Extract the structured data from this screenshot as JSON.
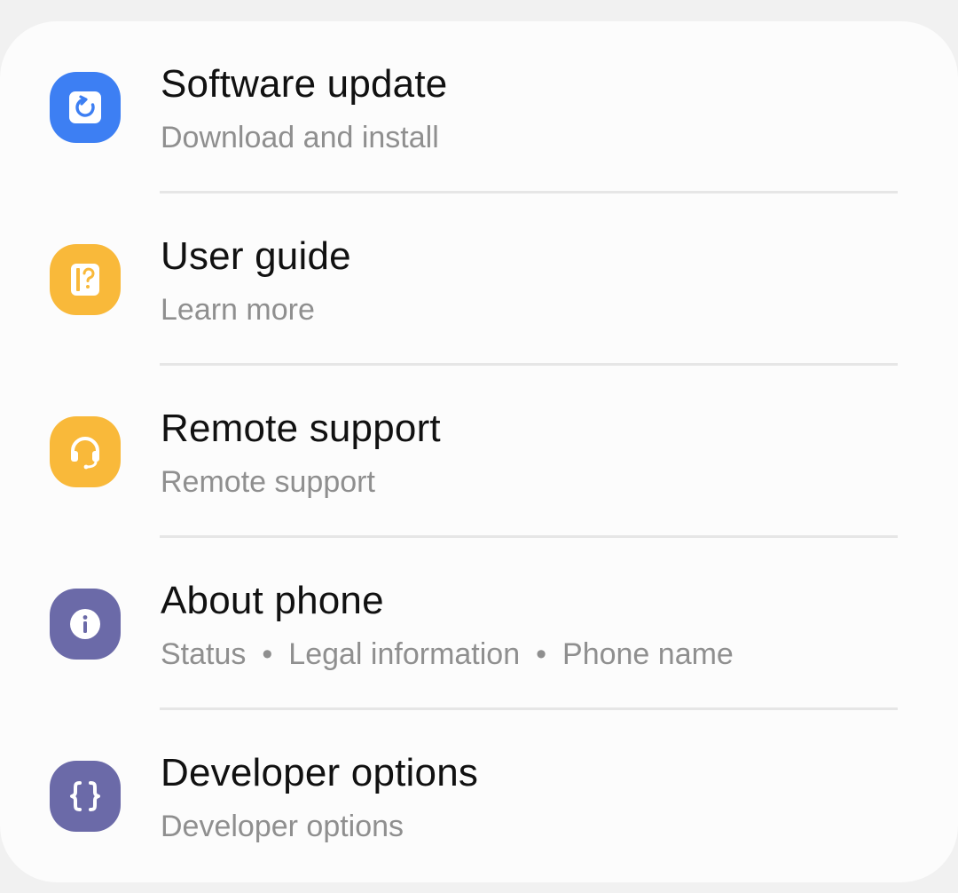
{
  "colors": {
    "software_update": "#3d7ff3",
    "user_guide": "#f9b93a",
    "remote_support": "#f9b93a",
    "about_phone": "#6b6aa8",
    "developer_options": "#6b6aa8"
  },
  "items": [
    {
      "icon": "refresh-icon",
      "title": "Software update",
      "subtitle": "Download and install"
    },
    {
      "icon": "book-help-icon",
      "title": "User guide",
      "subtitle": "Learn more"
    },
    {
      "icon": "headset-icon",
      "title": "Remote support",
      "subtitle": "Remote support"
    },
    {
      "icon": "info-icon",
      "title": "About phone",
      "subtitle_parts": [
        "Status",
        "Legal information",
        "Phone name"
      ]
    },
    {
      "icon": "code-braces-icon",
      "title": "Developer options",
      "subtitle": "Developer options"
    }
  ]
}
